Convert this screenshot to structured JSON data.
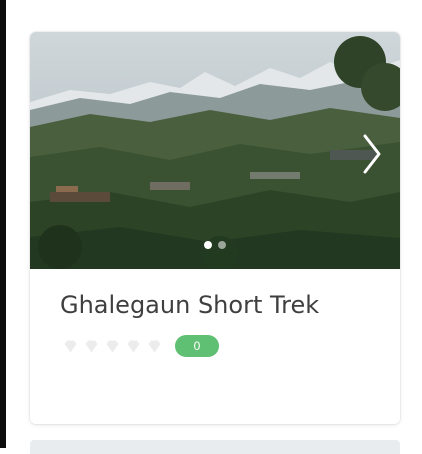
{
  "trek_card": {
    "title": "Ghalegaun Short Trek",
    "review_count": "0",
    "rating": 0,
    "rating_max": 5,
    "carousel": {
      "slide_count": 2,
      "active_slide": 1,
      "next_icon": "chevron-right-icon"
    }
  },
  "colors": {
    "badge_green": "#5fbf73",
    "title_text": "#3f3f3f",
    "star_empty": "#ececec"
  }
}
